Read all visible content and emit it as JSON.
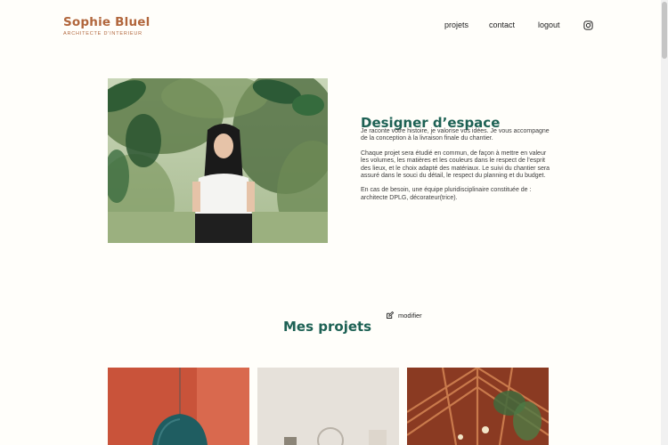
{
  "header": {
    "logo_title": "Sophie Bluel",
    "logo_subtitle": "ARCHITECTE D'INTERIEUR",
    "nav": [
      "projets",
      "contact",
      "logout"
    ],
    "instagram_icon": "instagram-icon"
  },
  "intro": {
    "title": "Designer d’espace",
    "paragraphs": [
      "Je raconte votre histoire, je valorise vos idées. Je vous accompagne de la conception à la livraison finale du chantier.",
      "Chaque projet sera étudié en commun, de façon à mettre en valeur les volumes, les matières et les couleurs dans le respect de l’esprit des lieux, et le choix adapté des matériaux. Le suivi du chantier sera assuré dans le souci du détail, le respect du planning et du budget.",
      "En cas de besoin, une équipe pluridisciplinaire constituée de : architecte DPLG, décorateur(trice)."
    ]
  },
  "projects": {
    "title": "Mes projets",
    "edit_label": "modifier"
  },
  "colors": {
    "brand": "#b1663c",
    "accent": "#1d6154",
    "background": "#fffefa"
  }
}
